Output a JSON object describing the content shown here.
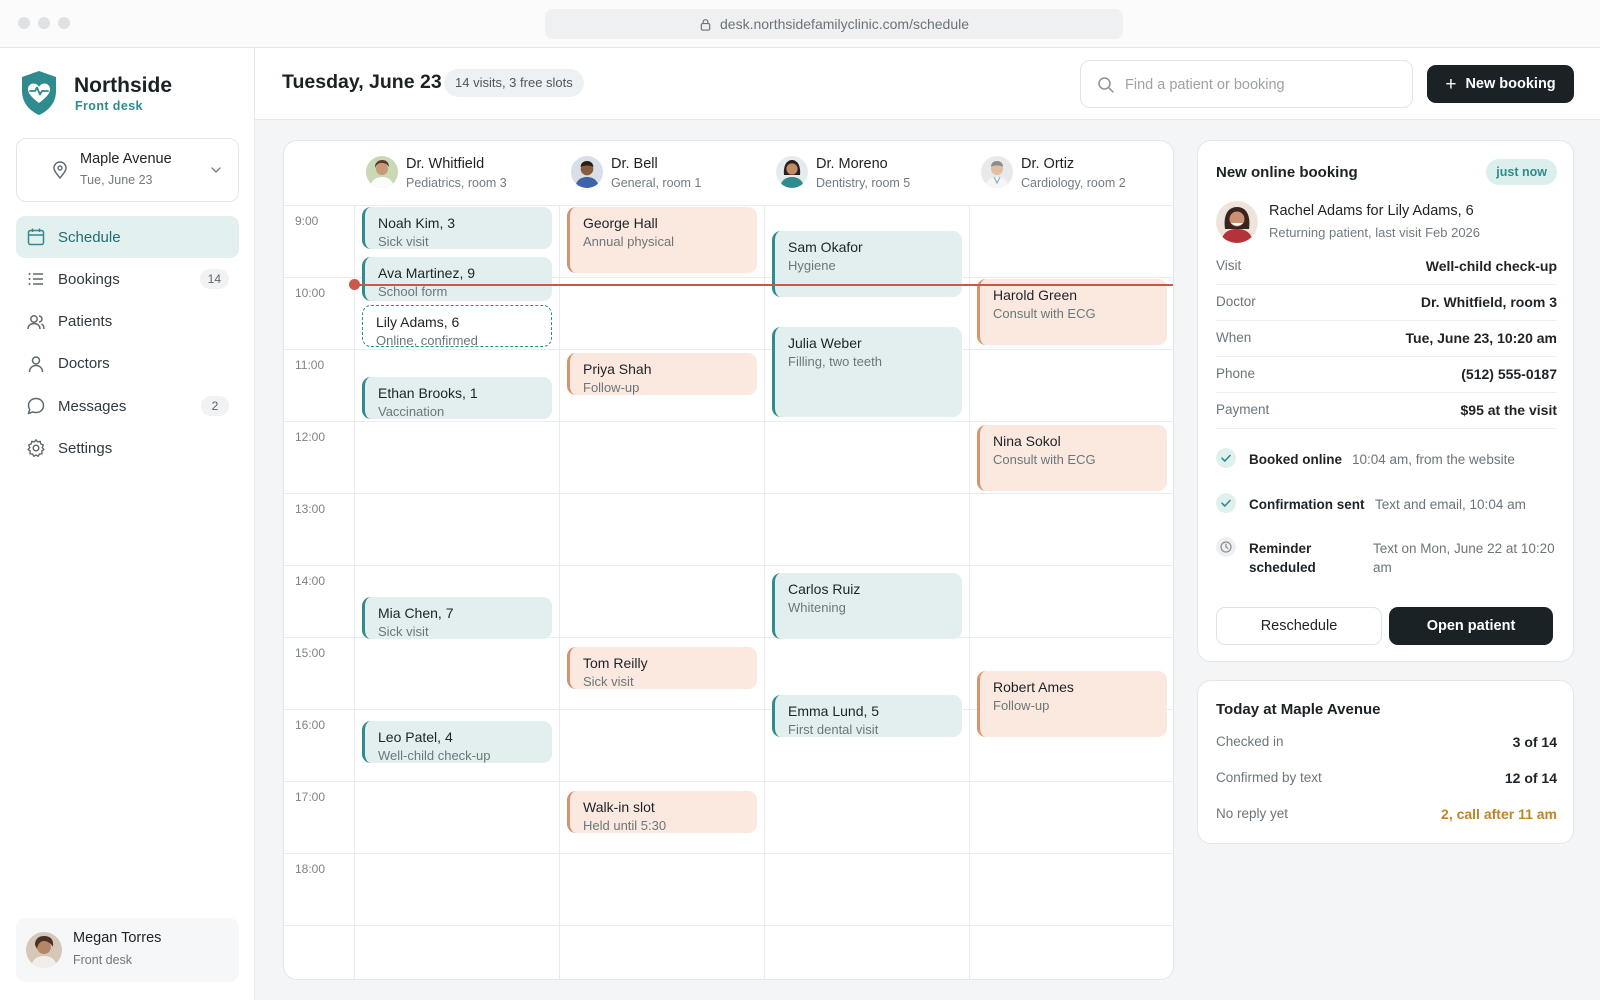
{
  "browser": {
    "url": "desk.northsidefamilyclinic.com/schedule"
  },
  "brand": {
    "name": "Northside",
    "sub": "Front desk",
    "accent": "#2f8b8d"
  },
  "location": {
    "name": "Maple Avenue",
    "date": "Tue, June 23"
  },
  "nav": {
    "schedule": "Schedule",
    "bookings": "Bookings",
    "bookings_count": "14",
    "patients": "Patients",
    "doctors": "Doctors",
    "messages": "Messages",
    "messages_count": "2",
    "settings": "Settings"
  },
  "user": {
    "name": "Megan Torres",
    "role": "Front desk"
  },
  "header": {
    "date": "Tuesday, June 23",
    "summary": "14 visits, 3 free slots",
    "search_placeholder": "Find a patient or booking",
    "new_booking": "New booking"
  },
  "calendar": {
    "hours": [
      "9:00",
      "10:00",
      "11:00",
      "12:00",
      "13:00",
      "14:00",
      "15:00",
      "16:00",
      "17:00",
      "18:00"
    ],
    "doctors": [
      {
        "name": "Dr. Whitfield",
        "room": "Pediatrics, room 3"
      },
      {
        "name": "Dr. Bell",
        "room": "General, room 1"
      },
      {
        "name": "Dr. Moreno",
        "room": "Dentistry, room 5"
      },
      {
        "name": "Dr. Ortiz",
        "room": "Cardiology, room 2"
      }
    ],
    "appointments": [
      {
        "name": "Noah Kim, 3",
        "detail": "Sick visit"
      },
      {
        "name": "Ava Martinez, 9",
        "detail": "School form"
      },
      {
        "name": "Lily Adams, 6",
        "detail": "Online, confirmed"
      },
      {
        "name": "Ethan Brooks, 1",
        "detail": "Vaccination"
      },
      {
        "name": "Mia Chen, 7",
        "detail": "Sick visit"
      },
      {
        "name": "Leo Patel, 4",
        "detail": "Well-child check-up"
      },
      {
        "name": "George Hall",
        "detail": "Annual physical"
      },
      {
        "name": "Priya Shah",
        "detail": "Follow-up"
      },
      {
        "name": "Tom Reilly",
        "detail": "Sick visit"
      },
      {
        "name": "Walk-in slot",
        "detail": "Held until 5:30"
      },
      {
        "name": "Sam Okafor",
        "detail": "Hygiene"
      },
      {
        "name": "Julia Weber",
        "detail": "Filling, two teeth"
      },
      {
        "name": "Carlos Ruiz",
        "detail": "Whitening"
      },
      {
        "name": "Emma Lund, 5",
        "detail": "First dental visit"
      },
      {
        "name": "Harold Green",
        "detail": "Consult with ECG"
      },
      {
        "name": "Nina Sokol",
        "detail": "Consult with ECG"
      },
      {
        "name": "Robert Ames",
        "detail": "Follow-up"
      }
    ]
  },
  "booking": {
    "title": "New online booking",
    "badge": "just now",
    "patient": "Rachel Adams for Lily Adams, 6",
    "patient_sub": "Returning patient, last visit Feb 2026",
    "fields": [
      {
        "k": "Visit",
        "v": "Well-child check-up"
      },
      {
        "k": "Doctor",
        "v": "Dr. Whitfield, room 3"
      },
      {
        "k": "When",
        "v": "Tue, June 23, 10:20 am"
      },
      {
        "k": "Phone",
        "v": "(512) 555-0187"
      },
      {
        "k": "Payment",
        "v": "$95 at the visit"
      }
    ],
    "timeline": [
      {
        "label": "Booked online",
        "value": "10:04 am, from the website",
        "icon": "check-icon"
      },
      {
        "label": "Confirmation sent",
        "value": "Text and email, 10:04 am",
        "icon": "check-icon"
      },
      {
        "label": "Reminder scheduled",
        "value": "Text on Mon, June 22 at 10:20 am",
        "icon": "clock-icon"
      }
    ],
    "reschedule": "Reschedule",
    "open_patient": "Open patient"
  },
  "today": {
    "title": "Today at Maple Avenue",
    "rows": [
      {
        "k": "Checked in",
        "v": "3 of 14"
      },
      {
        "k": "Confirmed by text",
        "v": "12 of 14"
      },
      {
        "k": "No reply yet",
        "v": "2, call after 11 am"
      }
    ],
    "warn_color": "#c08422"
  }
}
